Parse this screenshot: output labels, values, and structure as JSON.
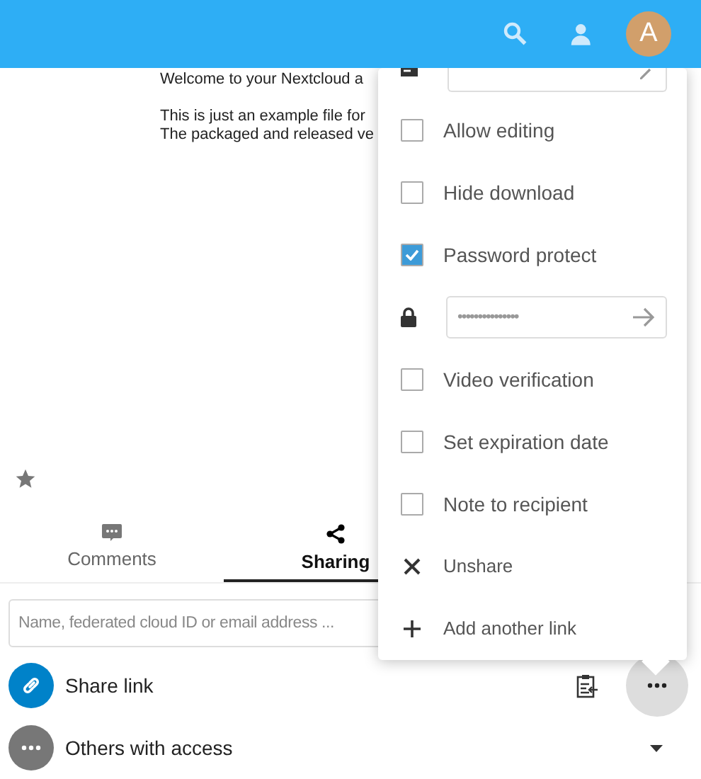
{
  "header": {
    "avatar": "A"
  },
  "preview": {
    "lines": [
      "Welcome to your Nextcloud a",
      "This is just an example file for",
      "The packaged and released ve"
    ]
  },
  "favorite": {
    "checked": false
  },
  "tabs": [
    {
      "label": "Comments",
      "selected": false
    },
    {
      "label": "Sharing",
      "selected": true
    }
  ],
  "search": {
    "placeholder": "Name, federated cloud ID or email address ..."
  },
  "shares": [
    {
      "kind": "link",
      "label": "Share link"
    },
    {
      "kind": "others",
      "label": "Others with access"
    }
  ],
  "menu": [
    {
      "kind": "field"
    },
    {
      "kind": "checkbox",
      "label": "Allow editing",
      "checked": false
    },
    {
      "kind": "checkbox",
      "label": "Hide download",
      "checked": false
    },
    {
      "kind": "checkbox",
      "label": "Password protect",
      "checked": true
    },
    {
      "kind": "password",
      "value": "•••••••••••••••"
    },
    {
      "kind": "checkbox",
      "label": "Video verification",
      "checked": false
    },
    {
      "kind": "checkbox",
      "label": "Set expiration date",
      "checked": false
    },
    {
      "kind": "checkbox",
      "label": "Note to recipient",
      "checked": false
    },
    {
      "kind": "remove",
      "label": "Unshare"
    },
    {
      "kind": "add",
      "label": "Add another link"
    }
  ]
}
